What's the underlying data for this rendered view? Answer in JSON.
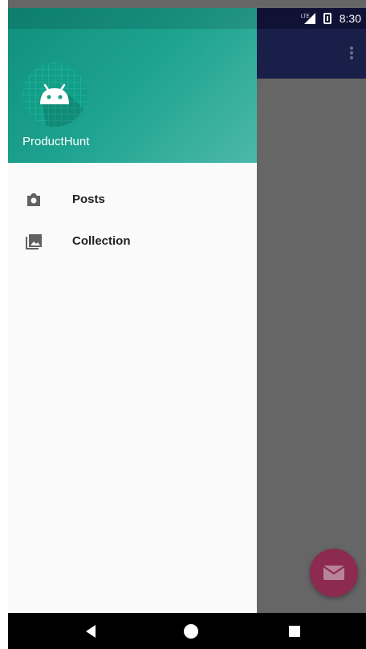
{
  "status_bar": {
    "network": "LTE",
    "time": "8:30"
  },
  "drawer": {
    "header": {
      "app_name": "ProductHunt"
    },
    "items": [
      {
        "label": "Posts",
        "icon": "camera-icon"
      },
      {
        "label": "Collection",
        "icon": "photo-library-icon"
      }
    ]
  },
  "fab": {
    "icon": "mail-icon"
  },
  "nav_bar": {
    "back_icon": "back-icon",
    "home_icon": "home-icon",
    "recents_icon": "recents-icon"
  },
  "colors": {
    "drawer_header_start": "#0f8f7d",
    "drawer_header_end": "#4cb8aa",
    "app_bar": "#1a1f4a",
    "fab": "#8c2a50",
    "scrim": "#666666"
  }
}
